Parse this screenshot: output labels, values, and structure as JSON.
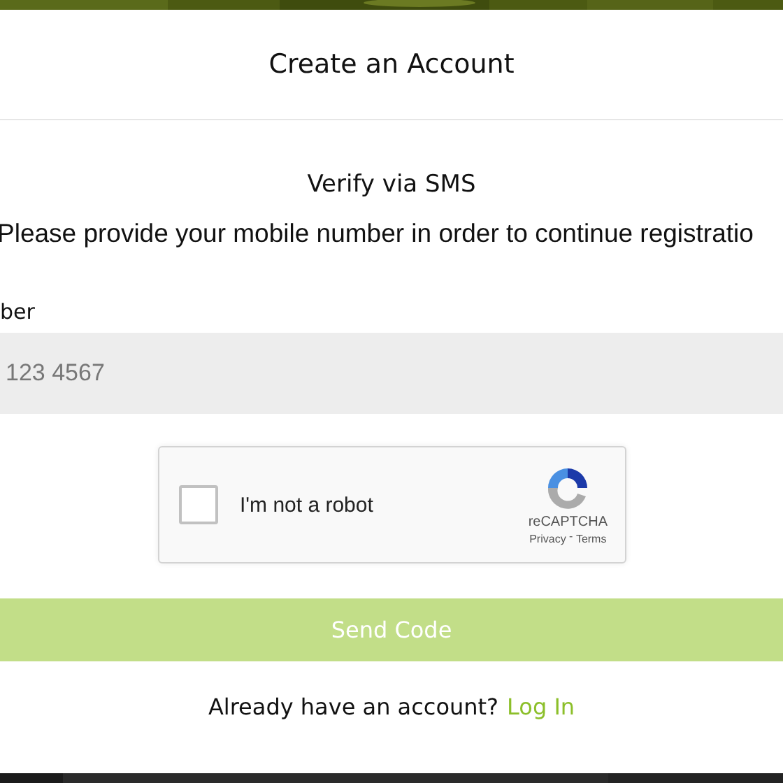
{
  "dialog": {
    "title": "Create an Account"
  },
  "section": {
    "heading": "Verify via SMS",
    "instruction": "Please provide your mobile number in order to continue registratio"
  },
  "phone_field": {
    "label": "ber",
    "placeholder": "123 4567"
  },
  "captcha": {
    "label": "I'm not a robot",
    "checked": false,
    "brand": "reCAPTCHA",
    "privacy": "Privacy",
    "separator": " - ",
    "terms": "Terms"
  },
  "send_button": {
    "label": "Send Code",
    "disabled": true
  },
  "footer": {
    "prompt": "Already have an account?",
    "link": "Log In"
  }
}
